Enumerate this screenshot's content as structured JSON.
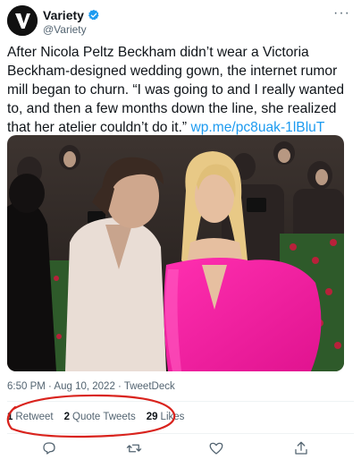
{
  "author": {
    "display_name": "Variety",
    "handle": "@Variety",
    "avatar_letter": "V"
  },
  "tweet": {
    "text": "After Nicola Peltz Beckham didn’t wear a Victoria Beckham-designed wedding gown, the internet rumor mill began to churn. “I was going to and I really wanted to, and then a few months down the line, she realized that her atelier couldn’t do it.” ",
    "link": "wp.me/pc8uak-1lBluT",
    "timestamp": "6:50 PM · Aug 10, 2022 · TweetDeck"
  },
  "stats": {
    "retweets_count": "1",
    "retweets_label": "Retweet",
    "quotes_count": "2",
    "quotes_label": "Quote Tweets",
    "likes_count": "29",
    "likes_label": "Likes"
  },
  "colors": {
    "link": "#1d9bf0",
    "verified": "#1d9bf0",
    "annotation": "#d9231d",
    "secondary_text": "#536471"
  },
  "icons": [
    "more-icon",
    "verified-badge-icon",
    "reply-icon",
    "retweet-icon",
    "like-icon",
    "share-icon"
  ]
}
